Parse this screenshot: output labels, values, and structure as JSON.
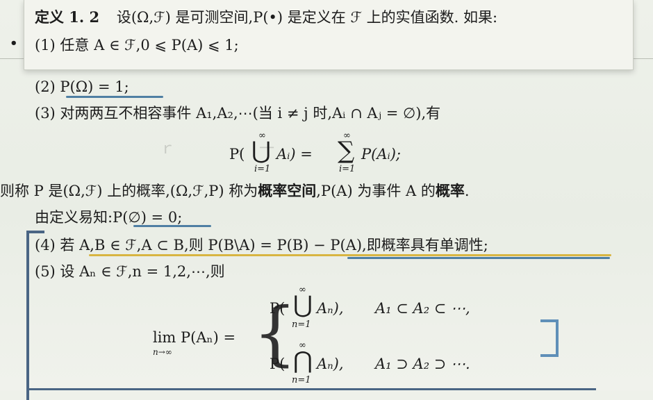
{
  "definition": {
    "heading": "定义 1. 2",
    "intro": "设(Ω,ℱ) 是可测空间,P(•) 是定义在 ℱ 上的实值函数. 如果:",
    "item1": "(1) 任意 A ∈ ℱ,0 ⩽ P(A) ⩽ 1;"
  },
  "items": {
    "item2": "(2) P(Ω) = 1;",
    "item3_text": "(3) 对两两互不相容事件 A₁,A₂,⋯(当 i ≠ j 时,Aᵢ ∩ Aⱼ = ∅),有",
    "item3_formula_left": "P(",
    "item3_union_arg": "Aᵢ) =",
    "item3_sum_arg": "P(Aᵢ);",
    "inf": "∞",
    "i_eq_1": "i=1",
    "conclusion_a": "则称 P 是(Ω,ℱ) 上的概率,(Ω,ℱ,P) 称为",
    "conclusion_bold1": "概率空间",
    "conclusion_b": ",P(A) 为事件 A 的",
    "conclusion_bold2": "概率",
    "conclusion_end": ".",
    "easy_prefix": "由定义易知:",
    "easy_formula": "P(∅) = 0",
    "easy_suffix": ";",
    "item4": "(4) 若 A,B ∈ ℱ,A ⊂ B,则 P(B\\A) = P(B) − P(A),即概率具有单调性;",
    "item5": "(5) 设 Aₙ ∈ ℱ,n = 1,2,⋯,则"
  },
  "limit_formula": {
    "lim_label": "lim P(Aₙ) =",
    "lim_sub": "n→∞",
    "case1_left": "P(",
    "case1_arg": "Aₙ),",
    "case1_cond": "A₁ ⊂ A₂ ⊂ ⋯,",
    "case2_left": "P(",
    "case2_arg": "Aₙ),",
    "case2_cond": "A₁ ⊃ A₂ ⊃ ⋯.",
    "inf": "∞",
    "n_eq_1": "n=1"
  },
  "colors": {
    "blue_annotation": "#4f7fa3",
    "gold_annotation": "#d8b542",
    "bracket": "#4a6584"
  }
}
